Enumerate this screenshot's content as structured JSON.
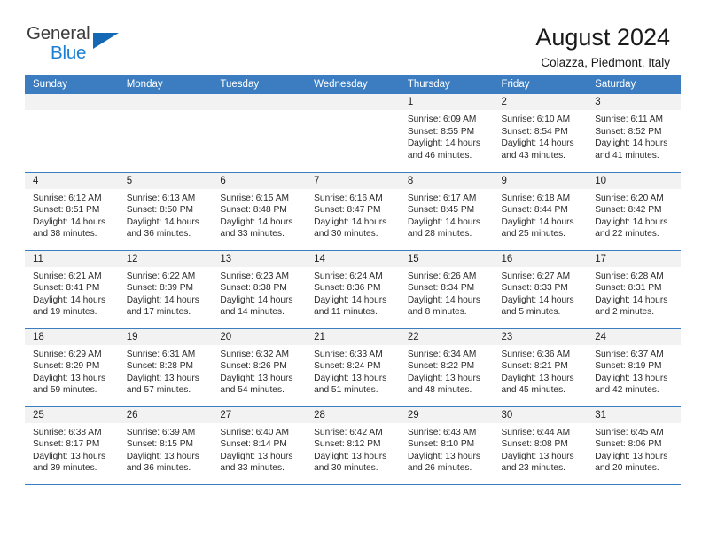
{
  "logo": {
    "word1": "General",
    "word2": "Blue",
    "triangle_color": "#1569b4",
    "blue_color": "#1c7fd4"
  },
  "header": {
    "title": "August 2024",
    "subtitle": "Colazza, Piedmont, Italy"
  },
  "theme": {
    "header_blue": "#3b7dc0",
    "daynum_gray": "#f2f2f2"
  },
  "weekday_headers": [
    "Sunday",
    "Monday",
    "Tuesday",
    "Wednesday",
    "Thursday",
    "Friday",
    "Saturday"
  ],
  "weeks": [
    [
      {
        "day": "",
        "empty": true
      },
      {
        "day": "",
        "empty": true
      },
      {
        "day": "",
        "empty": true
      },
      {
        "day": "",
        "empty": true
      },
      {
        "day": "1",
        "sunrise": "Sunrise: 6:09 AM",
        "sunset": "Sunset: 8:55 PM",
        "daylight1": "Daylight: 14 hours",
        "daylight2": "and 46 minutes."
      },
      {
        "day": "2",
        "sunrise": "Sunrise: 6:10 AM",
        "sunset": "Sunset: 8:54 PM",
        "daylight1": "Daylight: 14 hours",
        "daylight2": "and 43 minutes."
      },
      {
        "day": "3",
        "sunrise": "Sunrise: 6:11 AM",
        "sunset": "Sunset: 8:52 PM",
        "daylight1": "Daylight: 14 hours",
        "daylight2": "and 41 minutes."
      }
    ],
    [
      {
        "day": "4",
        "sunrise": "Sunrise: 6:12 AM",
        "sunset": "Sunset: 8:51 PM",
        "daylight1": "Daylight: 14 hours",
        "daylight2": "and 38 minutes."
      },
      {
        "day": "5",
        "sunrise": "Sunrise: 6:13 AM",
        "sunset": "Sunset: 8:50 PM",
        "daylight1": "Daylight: 14 hours",
        "daylight2": "and 36 minutes."
      },
      {
        "day": "6",
        "sunrise": "Sunrise: 6:15 AM",
        "sunset": "Sunset: 8:48 PM",
        "daylight1": "Daylight: 14 hours",
        "daylight2": "and 33 minutes."
      },
      {
        "day": "7",
        "sunrise": "Sunrise: 6:16 AM",
        "sunset": "Sunset: 8:47 PM",
        "daylight1": "Daylight: 14 hours",
        "daylight2": "and 30 minutes."
      },
      {
        "day": "8",
        "sunrise": "Sunrise: 6:17 AM",
        "sunset": "Sunset: 8:45 PM",
        "daylight1": "Daylight: 14 hours",
        "daylight2": "and 28 minutes."
      },
      {
        "day": "9",
        "sunrise": "Sunrise: 6:18 AM",
        "sunset": "Sunset: 8:44 PM",
        "daylight1": "Daylight: 14 hours",
        "daylight2": "and 25 minutes."
      },
      {
        "day": "10",
        "sunrise": "Sunrise: 6:20 AM",
        "sunset": "Sunset: 8:42 PM",
        "daylight1": "Daylight: 14 hours",
        "daylight2": "and 22 minutes."
      }
    ],
    [
      {
        "day": "11",
        "sunrise": "Sunrise: 6:21 AM",
        "sunset": "Sunset: 8:41 PM",
        "daylight1": "Daylight: 14 hours",
        "daylight2": "and 19 minutes."
      },
      {
        "day": "12",
        "sunrise": "Sunrise: 6:22 AM",
        "sunset": "Sunset: 8:39 PM",
        "daylight1": "Daylight: 14 hours",
        "daylight2": "and 17 minutes."
      },
      {
        "day": "13",
        "sunrise": "Sunrise: 6:23 AM",
        "sunset": "Sunset: 8:38 PM",
        "daylight1": "Daylight: 14 hours",
        "daylight2": "and 14 minutes."
      },
      {
        "day": "14",
        "sunrise": "Sunrise: 6:24 AM",
        "sunset": "Sunset: 8:36 PM",
        "daylight1": "Daylight: 14 hours",
        "daylight2": "and 11 minutes."
      },
      {
        "day": "15",
        "sunrise": "Sunrise: 6:26 AM",
        "sunset": "Sunset: 8:34 PM",
        "daylight1": "Daylight: 14 hours",
        "daylight2": "and 8 minutes."
      },
      {
        "day": "16",
        "sunrise": "Sunrise: 6:27 AM",
        "sunset": "Sunset: 8:33 PM",
        "daylight1": "Daylight: 14 hours",
        "daylight2": "and 5 minutes."
      },
      {
        "day": "17",
        "sunrise": "Sunrise: 6:28 AM",
        "sunset": "Sunset: 8:31 PM",
        "daylight1": "Daylight: 14 hours",
        "daylight2": "and 2 minutes."
      }
    ],
    [
      {
        "day": "18",
        "sunrise": "Sunrise: 6:29 AM",
        "sunset": "Sunset: 8:29 PM",
        "daylight1": "Daylight: 13 hours",
        "daylight2": "and 59 minutes."
      },
      {
        "day": "19",
        "sunrise": "Sunrise: 6:31 AM",
        "sunset": "Sunset: 8:28 PM",
        "daylight1": "Daylight: 13 hours",
        "daylight2": "and 57 minutes."
      },
      {
        "day": "20",
        "sunrise": "Sunrise: 6:32 AM",
        "sunset": "Sunset: 8:26 PM",
        "daylight1": "Daylight: 13 hours",
        "daylight2": "and 54 minutes."
      },
      {
        "day": "21",
        "sunrise": "Sunrise: 6:33 AM",
        "sunset": "Sunset: 8:24 PM",
        "daylight1": "Daylight: 13 hours",
        "daylight2": "and 51 minutes."
      },
      {
        "day": "22",
        "sunrise": "Sunrise: 6:34 AM",
        "sunset": "Sunset: 8:22 PM",
        "daylight1": "Daylight: 13 hours",
        "daylight2": "and 48 minutes."
      },
      {
        "day": "23",
        "sunrise": "Sunrise: 6:36 AM",
        "sunset": "Sunset: 8:21 PM",
        "daylight1": "Daylight: 13 hours",
        "daylight2": "and 45 minutes."
      },
      {
        "day": "24",
        "sunrise": "Sunrise: 6:37 AM",
        "sunset": "Sunset: 8:19 PM",
        "daylight1": "Daylight: 13 hours",
        "daylight2": "and 42 minutes."
      }
    ],
    [
      {
        "day": "25",
        "sunrise": "Sunrise: 6:38 AM",
        "sunset": "Sunset: 8:17 PM",
        "daylight1": "Daylight: 13 hours",
        "daylight2": "and 39 minutes."
      },
      {
        "day": "26",
        "sunrise": "Sunrise: 6:39 AM",
        "sunset": "Sunset: 8:15 PM",
        "daylight1": "Daylight: 13 hours",
        "daylight2": "and 36 minutes."
      },
      {
        "day": "27",
        "sunrise": "Sunrise: 6:40 AM",
        "sunset": "Sunset: 8:14 PM",
        "daylight1": "Daylight: 13 hours",
        "daylight2": "and 33 minutes."
      },
      {
        "day": "28",
        "sunrise": "Sunrise: 6:42 AM",
        "sunset": "Sunset: 8:12 PM",
        "daylight1": "Daylight: 13 hours",
        "daylight2": "and 30 minutes."
      },
      {
        "day": "29",
        "sunrise": "Sunrise: 6:43 AM",
        "sunset": "Sunset: 8:10 PM",
        "daylight1": "Daylight: 13 hours",
        "daylight2": "and 26 minutes."
      },
      {
        "day": "30",
        "sunrise": "Sunrise: 6:44 AM",
        "sunset": "Sunset: 8:08 PM",
        "daylight1": "Daylight: 13 hours",
        "daylight2": "and 23 minutes."
      },
      {
        "day": "31",
        "sunrise": "Sunrise: 6:45 AM",
        "sunset": "Sunset: 8:06 PM",
        "daylight1": "Daylight: 13 hours",
        "daylight2": "and 20 minutes."
      }
    ]
  ]
}
